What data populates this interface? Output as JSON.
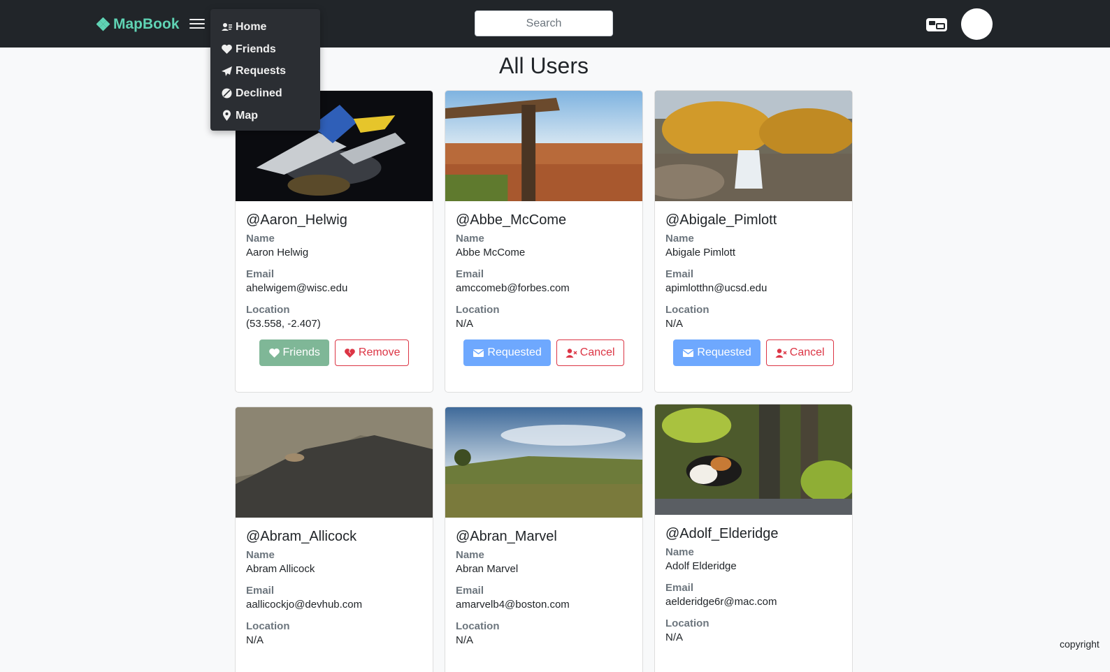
{
  "nav": {
    "brand": "MapBook",
    "search_placeholder": "Search",
    "menu": [
      {
        "label": "Home",
        "icon": "users-icon"
      },
      {
        "label": "Friends",
        "icon": "heart-icon"
      },
      {
        "label": "Requests",
        "icon": "paper-plane-icon"
      },
      {
        "label": "Declined",
        "icon": "ban-icon"
      },
      {
        "label": "Map",
        "icon": "map-pin-icon"
      }
    ]
  },
  "page": {
    "title": "All Users"
  },
  "labels": {
    "name": "Name",
    "email": "Email",
    "location": "Location"
  },
  "users": [
    {
      "username": "@Aaron_Helwig",
      "name": "Aaron Helwig",
      "email": "ahelwigem@wisc.edu",
      "location": "(53.558, -2.407)",
      "primary_action": "Friends",
      "secondary_action": "Remove"
    },
    {
      "username": "@Abbe_McCome",
      "name": "Abbe McCome",
      "email": "amccomeb@forbes.com",
      "location": "N/A",
      "primary_action": "Requested",
      "secondary_action": "Cancel"
    },
    {
      "username": "@Abigale_Pimlott",
      "name": "Abigale Pimlott",
      "email": "apimlotthn@ucsd.edu",
      "location": "N/A",
      "primary_action": "Requested",
      "secondary_action": "Cancel"
    },
    {
      "username": "@Abram_Allicock",
      "name": "Abram Allicock",
      "email": "aallicockjo@devhub.com",
      "location": "N/A"
    },
    {
      "username": "@Abran_Marvel",
      "name": "Abran Marvel",
      "email": "amarvelb4@boston.com",
      "location": "N/A"
    },
    {
      "username": "@Adolf_Elderidge",
      "name": "Adolf Elderidge",
      "email": "aelderidge6r@mac.com",
      "location": "N/A"
    }
  ],
  "footer": {
    "copyright": "copyright"
  },
  "colors": {
    "navbar": "#212529",
    "brand": "#5fd3b4",
    "friends_button": "#7fb797",
    "requested_button": "#6ea8fe",
    "danger": "#dc3545"
  }
}
